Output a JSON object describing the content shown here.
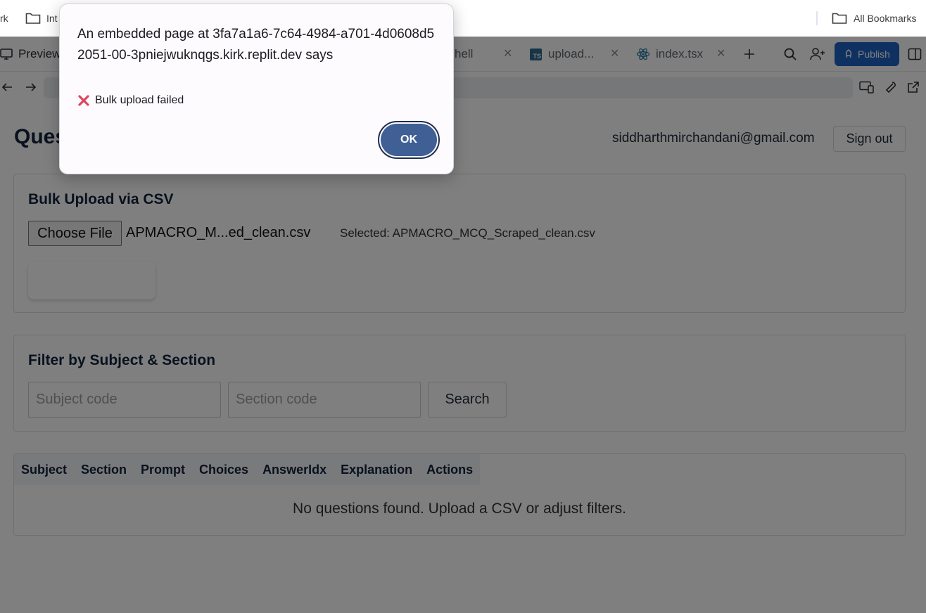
{
  "bookmarks": {
    "item_left_partial": "rk",
    "folder1_label": "Int",
    "all_bookmarks": "All Bookmarks"
  },
  "tabs": {
    "preview_label": "Preview",
    "shell_partial": "hell",
    "upload_label": "upload...",
    "upload_badge": "TS",
    "index_label": "index.tsx",
    "publish_label": "Publish"
  },
  "header": {
    "title": "Questions",
    "user_email": "siddharthmirchandani@gmail.com",
    "sign_out": "Sign out"
  },
  "bulk_upload": {
    "title": "Bulk Upload via CSV",
    "choose_file": "Choose File",
    "file_name": "APMACRO_M...ed_clean.csv",
    "selected_text": "Selected: APMACRO_MCQ_Scraped_clean.csv"
  },
  "filter": {
    "title": "Filter by Subject & Section",
    "subject_placeholder": "Subject code",
    "section_placeholder": "Section code",
    "search_label": "Search"
  },
  "table": {
    "columns": [
      "Subject",
      "Section",
      "Prompt",
      "Choices",
      "AnswerIdx",
      "Explanation",
      "Actions"
    ],
    "empty_message": "No questions found. Upload a CSV or adjust filters."
  },
  "dialog": {
    "title": "An embedded page at 3fa7a1a6-7c64-4984-a701-4d0608d52051-00-3pniejwuknqgs.kirk.replit.dev says",
    "message": "Bulk upload failed",
    "ok_label": "OK"
  },
  "colors": {
    "publish_blue": "#1e63c4",
    "ok_button": "#3f5f95",
    "error_icon": "#e0455d"
  }
}
